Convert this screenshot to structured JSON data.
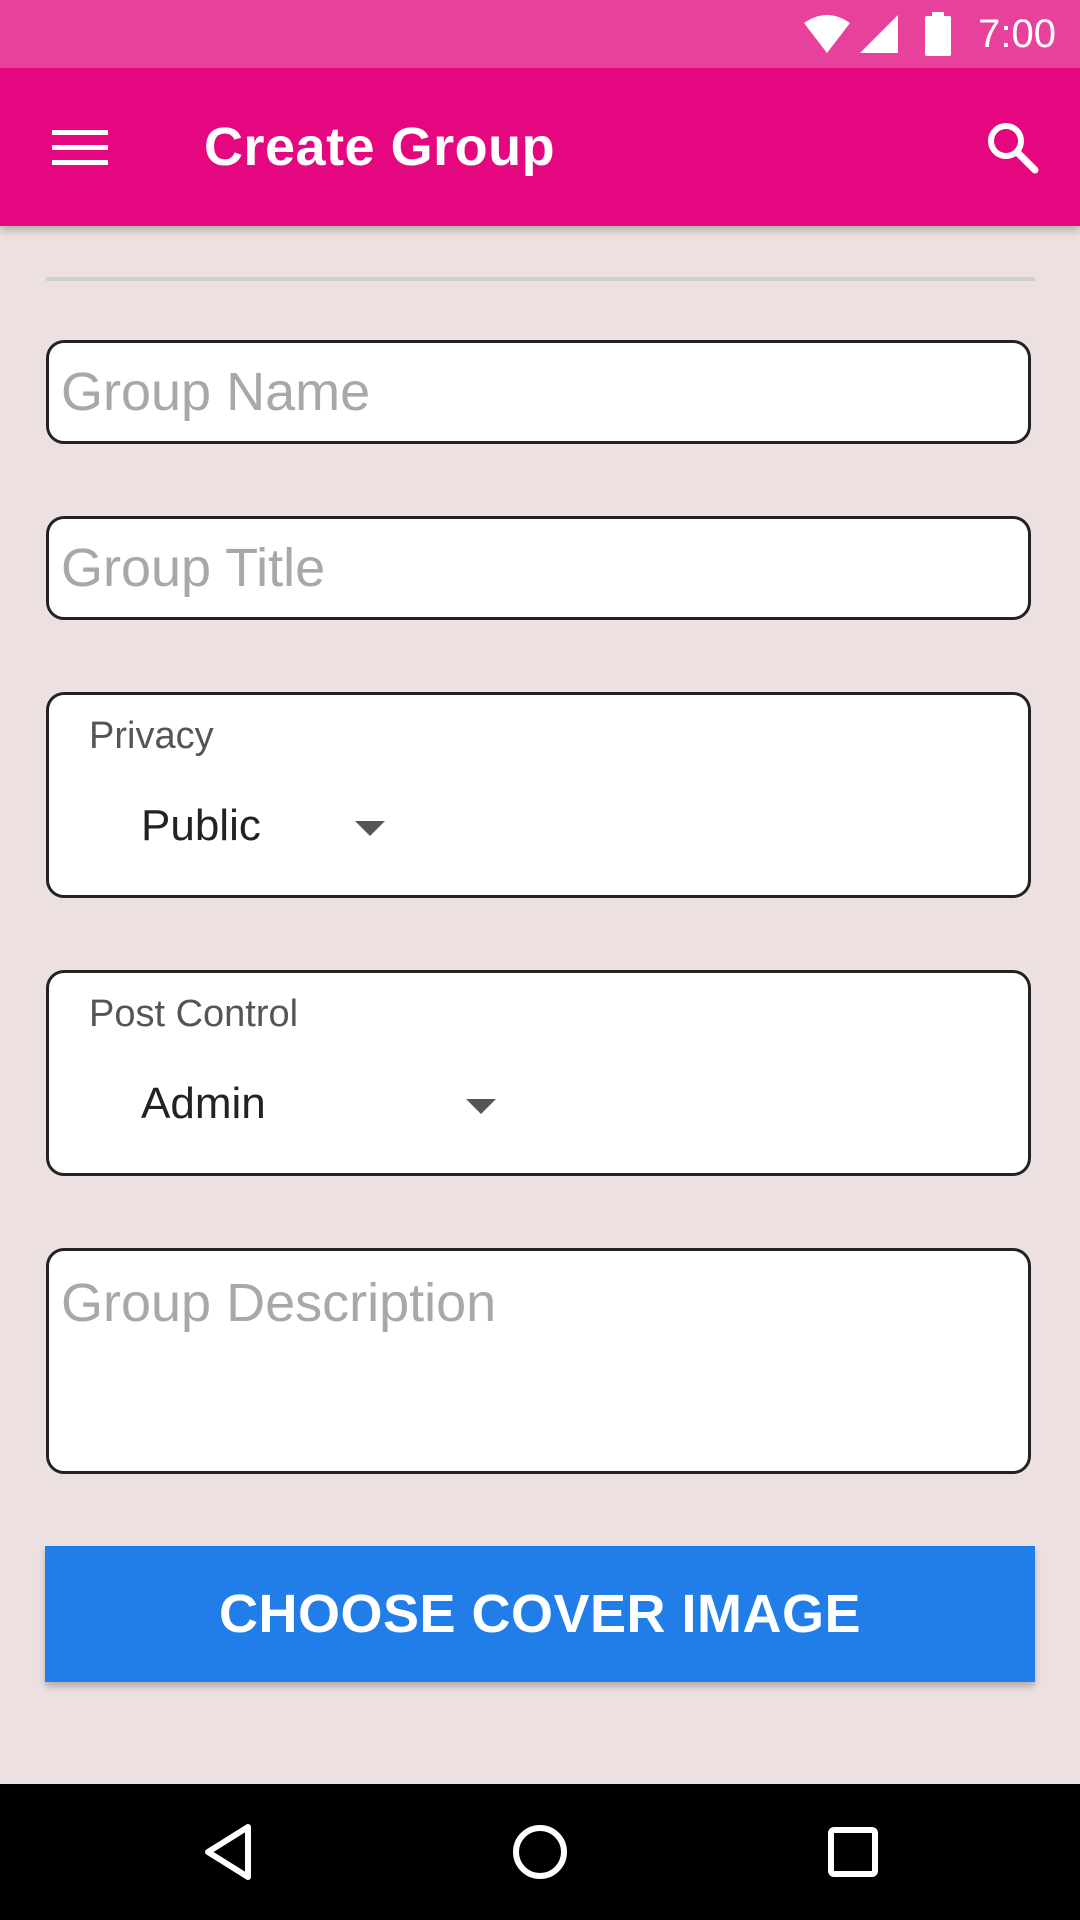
{
  "status_bar": {
    "time": "7:00"
  },
  "app_bar": {
    "title": "Create Group",
    "menu_icon": "menu-icon",
    "search_icon": "search-icon"
  },
  "form": {
    "group_name": {
      "value": "",
      "placeholder": "Group Name"
    },
    "group_title": {
      "value": "",
      "placeholder": "Group Title"
    },
    "privacy": {
      "label": "Privacy",
      "selected": "Public"
    },
    "post_control": {
      "label": "Post Control",
      "selected": "Admin"
    },
    "group_description": {
      "value": "",
      "placeholder": "Group Description"
    },
    "cover_button_label": "CHOOSE COVER IMAGE"
  },
  "colors": {
    "status_bar": "#e8419b",
    "app_bar": "#e4077f",
    "background": "#ece0e0",
    "button": "#217ee8"
  },
  "nav_bar": {
    "icons": [
      "back-icon",
      "home-icon",
      "recents-icon"
    ]
  }
}
